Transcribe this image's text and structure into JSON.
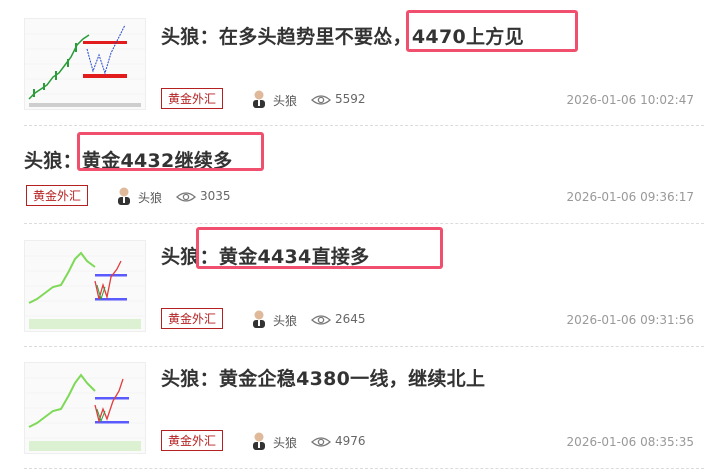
{
  "articles": [
    {
      "title": "头狼：在多头趋势里不要怂，4470上方见",
      "tag": "黄金外汇",
      "author": "头狼",
      "views": "5592",
      "time": "2026-01-06 10:02:47"
    },
    {
      "title": "头狼：黄金4432继续多",
      "tag": "黄金外汇",
      "author": "头狼",
      "views": "3035",
      "time": "2026-01-06 09:36:17"
    },
    {
      "title": "头狼：黄金4434直接多",
      "tag": "黄金外汇",
      "author": "头狼",
      "views": "2645",
      "time": "2026-01-06 09:31:56"
    },
    {
      "title": "头狼：黄金企稳4380一线，继续北上",
      "tag": "黄金外汇",
      "author": "头狼",
      "views": "4976",
      "time": "2026-01-06 08:35:35"
    }
  ],
  "colors": {
    "tag": "#b52020",
    "highlight": "#f0506e"
  },
  "icons": {
    "views": "eye-icon",
    "author": "avatar"
  }
}
